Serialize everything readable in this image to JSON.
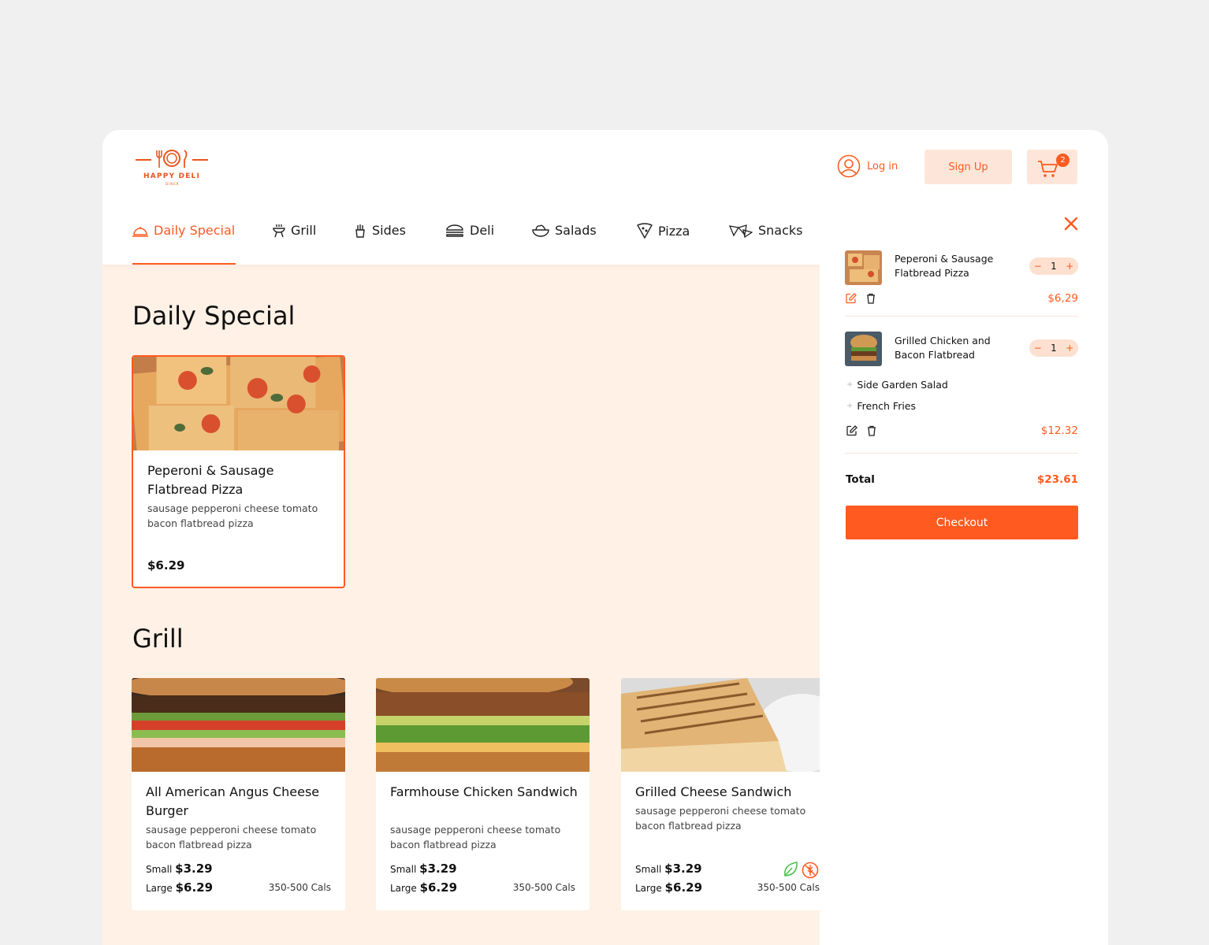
{
  "brand": {
    "name": "HAPPY DELI",
    "sub": "DINER"
  },
  "header": {
    "login_label": "Log in",
    "signup_label": "Sign Up",
    "cart_count": "2"
  },
  "tabs": [
    {
      "label": "Daily Special",
      "icon": "cloche-icon",
      "active": true
    },
    {
      "label": "Grill",
      "icon": "grill-icon"
    },
    {
      "label": "Sides",
      "icon": "fries-icon"
    },
    {
      "label": "Deli",
      "icon": "sandwich-icon"
    },
    {
      "label": "Salads",
      "icon": "salad-bowl-icon"
    },
    {
      "label": "Pizza",
      "icon": "pizza-slice-icon"
    },
    {
      "label": "Snacks",
      "icon": "nachos-icon"
    }
  ],
  "sections": {
    "daily_special": {
      "title": "Daily Special",
      "items": [
        {
          "name": "Peperoni & Sausage Flatbread Pizza",
          "desc": "sausage pepperoni cheese tomato bacon flatbread pizza",
          "price": "$6.29"
        }
      ]
    },
    "grill": {
      "title": "Grill",
      "items": [
        {
          "name": "All American Angus Cheese Burger",
          "desc": "sausage pepperoni cheese tomato bacon flatbread pizza",
          "small_label": "Small",
          "small_price": "$3.29",
          "large_label": "Large",
          "large_price": "$6.29",
          "cals": "350-500 Cals"
        },
        {
          "name": "Farmhouse Chicken Sandwich",
          "desc": "sausage pepperoni cheese tomato bacon flatbread pizza",
          "small_label": "Small",
          "small_price": "$3.29",
          "large_label": "Large",
          "large_price": "$6.29",
          "cals": "350-500 Cals"
        },
        {
          "name": "Grilled Cheese Sandwich",
          "desc": "sausage pepperoni cheese tomato bacon flatbread pizza",
          "small_label": "Small",
          "small_price": "$3.29",
          "large_label": "Large",
          "large_price": "$6.29",
          "cals": "350-500 Cals",
          "badges": [
            "leaf-icon",
            "no-gluten-icon"
          ]
        }
      ]
    }
  },
  "cart": {
    "items": [
      {
        "name": "Peperoni & Sausage Flatbread Pizza",
        "qty": "1",
        "minus": "−",
        "plus": "+",
        "price": "$6,29"
      },
      {
        "name": "Grilled Chicken and Bacon Flatbread",
        "qty": "1",
        "minus": "−",
        "plus": "+",
        "price": "$12.32",
        "addons": [
          "Side Garden Salad",
          "French Fries"
        ]
      }
    ],
    "addon_marker": "+",
    "total_label": "Total",
    "total_value": "$23.61",
    "checkout_label": "Checkout"
  },
  "colors": {
    "accent": "#ff5a1f",
    "accent_soft": "#fde6d9",
    "page_bg": "#fff1e6",
    "outer_bg": "#f0f0f0"
  }
}
